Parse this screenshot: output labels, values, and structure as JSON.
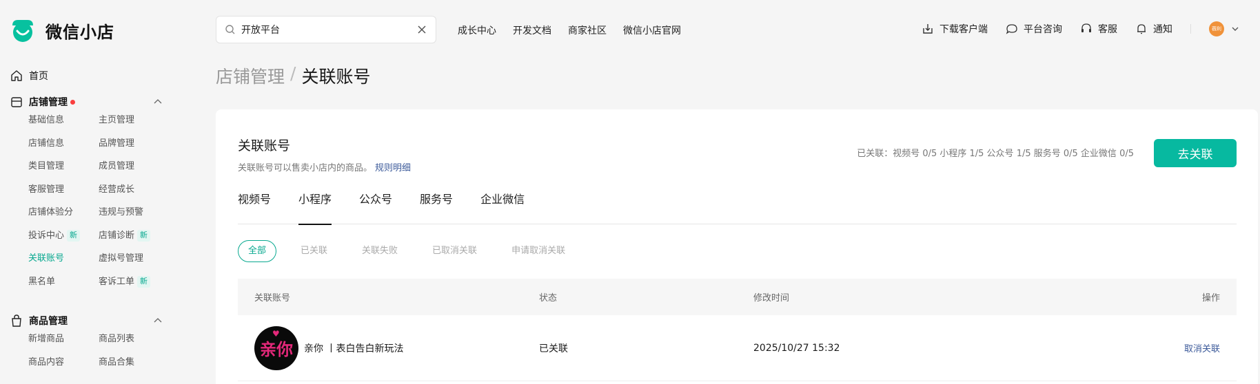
{
  "app": {
    "name": "微信小店"
  },
  "search": {
    "value": "开放平台"
  },
  "topnav": [
    "成长中心",
    "开发文档",
    "商家社区",
    "微信小店官网"
  ],
  "tools": {
    "download": "下载客户端",
    "consult": "平台咨询",
    "service": "客服",
    "notify": "通知"
  },
  "user": {
    "avatar_text": "薇利"
  },
  "sidebar": {
    "home": "首页",
    "store_group": {
      "title": "店铺管理",
      "items": [
        {
          "label": "基础信息"
        },
        {
          "label": "主页管理"
        },
        {
          "label": "店铺信息"
        },
        {
          "label": "品牌管理"
        },
        {
          "label": "类目管理"
        },
        {
          "label": "成员管理"
        },
        {
          "label": "客服管理"
        },
        {
          "label": "经营成长"
        },
        {
          "label": "店铺体验分"
        },
        {
          "label": "违规与预警"
        },
        {
          "label": "投诉中心",
          "badge": "新"
        },
        {
          "label": "店铺诊断",
          "badge": "新"
        },
        {
          "label": "关联账号",
          "active": true
        },
        {
          "label": "虚拟号管理"
        },
        {
          "label": "黑名单"
        },
        {
          "label": "客诉工单",
          "badge": "新"
        }
      ]
    },
    "goods_group": {
      "title": "商品管理",
      "items": [
        {
          "label": "新增商品"
        },
        {
          "label": "商品列表"
        },
        {
          "label": "商品内容"
        },
        {
          "label": "商品合集"
        }
      ]
    }
  },
  "breadcrumb": {
    "parent": "店铺管理",
    "sep": "/",
    "current": "关联账号"
  },
  "card": {
    "title": "关联账号",
    "desc": "关联账号可以售卖小店内的商品。",
    "rules_link": "规则明细",
    "stats": "已关联：视频号 0/5  小程序 1/5  公众号 1/5  服务号 0/5  企业微信 0/5",
    "button": "去关联",
    "tabs": [
      "视频号",
      "小程序",
      "公众号",
      "服务号",
      "企业微信"
    ],
    "active_tab": "小程序",
    "filters": [
      "全部",
      "已关联",
      "关联失败",
      "已取消关联",
      "申请取消关联"
    ],
    "active_filter": "全部"
  },
  "table": {
    "headers": {
      "account": "关联账号",
      "status": "状态",
      "time": "修改时间",
      "action": "操作"
    },
    "rows": [
      {
        "avatar_text": "亲你",
        "name": "亲你 丨表白告白新玩法",
        "status": "已关联",
        "time": "2025/10/27 15:32",
        "action": "取消关联"
      }
    ]
  },
  "colors": {
    "accent": "#07b9a0",
    "link": "#3c5a9a",
    "dot": "#fa3e3e"
  }
}
